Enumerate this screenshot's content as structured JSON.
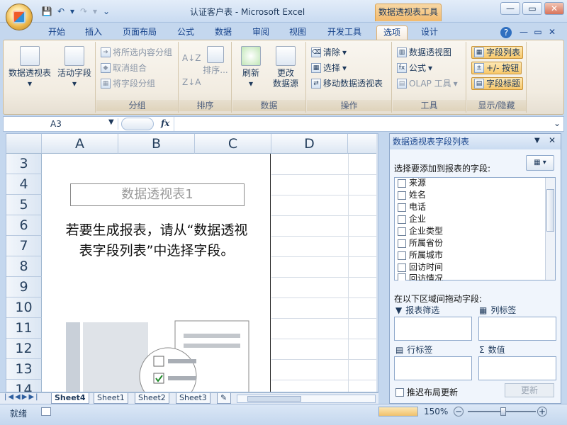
{
  "window": {
    "title": "认证客户表 - Microsoft Excel",
    "context_tab": "数据透视表工具",
    "min": "—",
    "max": "▭",
    "close": "✕"
  },
  "ribbon_tabs": [
    "开始",
    "插入",
    "页面布局",
    "公式",
    "数据",
    "审阅",
    "视图",
    "开发工具",
    "选项",
    "设计"
  ],
  "ribbon_right": {
    "help": "?",
    "min": "—",
    "restore": "▭",
    "close": "✕"
  },
  "groups": {
    "g1": {
      "btn1": "数据透视表",
      "btn2": "活动字段"
    },
    "fenzu": {
      "label": "分组",
      "items": [
        "将所选内容分组",
        "取消组合",
        "将字段分组"
      ]
    },
    "paixu": {
      "label": "排序",
      "az": "A↓Z",
      "za": "Z↓A",
      "sort": "排序..."
    },
    "shuju": {
      "label": "数据",
      "refresh": "刷新",
      "change1": "更改",
      "change2": "数据源"
    },
    "caozuo": {
      "label": "操作",
      "items": [
        "清除",
        "选择",
        "移动数据透视表"
      ]
    },
    "gongju": {
      "label": "工具",
      "items": [
        "数据透视图",
        "公式",
        "OLAP 工具"
      ]
    },
    "xianshi": {
      "label": "显示/隐藏",
      "items": [
        "字段列表",
        "+/- 按钮",
        "字段标题"
      ]
    }
  },
  "formula_bar": {
    "cell": "A3",
    "fx": "fx"
  },
  "grid": {
    "columns": [
      "A",
      "B",
      "C",
      "D"
    ],
    "rows": [
      "3",
      "4",
      "5",
      "6",
      "7",
      "8",
      "9",
      "10",
      "11",
      "12",
      "13",
      "14"
    ],
    "pivot_title": "数据透视表1",
    "pivot_message_line1": "若要生成报表，请从“数据透视",
    "pivot_message_line2": "表字段列表”中选择字段。"
  },
  "sheet_tabs": [
    "Sheet4",
    "Sheet1",
    "Sheet2",
    "Sheet3"
  ],
  "status": {
    "ready": "就绪",
    "zoom": "150%"
  },
  "field_list": {
    "title": "数据透视表字段列表",
    "choose_label": "选择要添加到报表的字段:",
    "fields": [
      "来源",
      "姓名",
      "电话",
      "企业",
      "企业类型",
      "所属省份",
      "所属城市",
      "回访时间",
      "回访情况"
    ],
    "drag_label": "在以下区域间拖动字段:",
    "zones": {
      "filter": "报表筛选",
      "columns": "列标签",
      "rows": "行标签",
      "values": "数值"
    },
    "defer_label": "推迟布局更新",
    "update_btn": "更新"
  }
}
